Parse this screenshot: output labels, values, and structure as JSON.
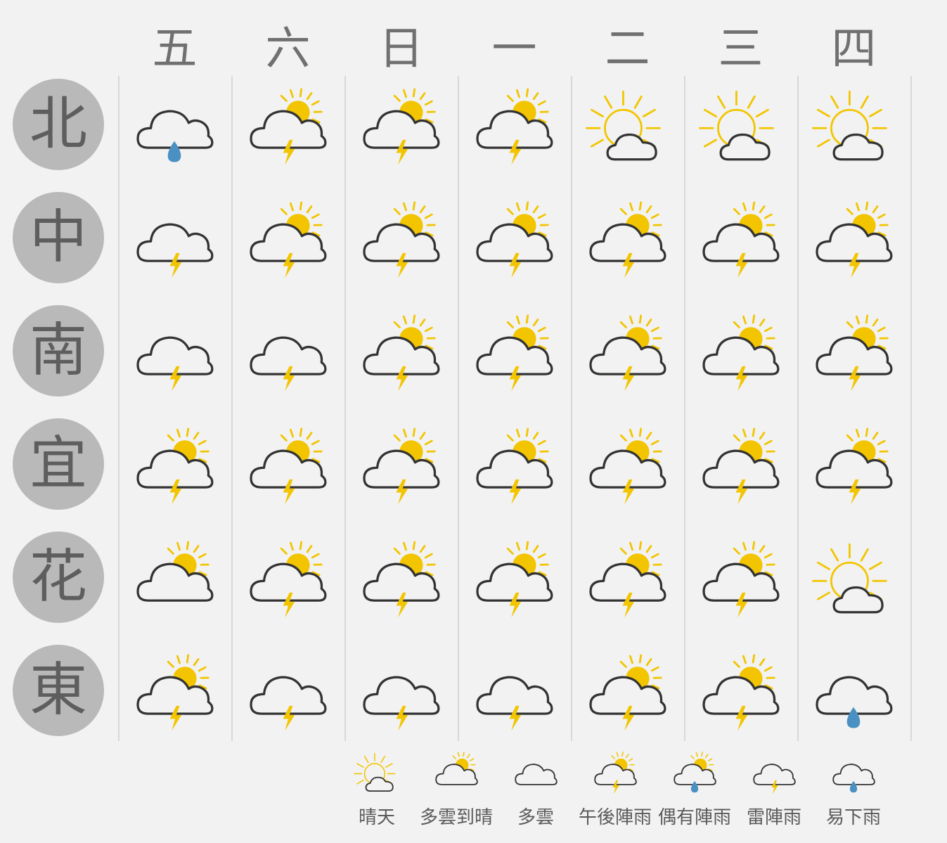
{
  "days": [
    "五",
    "六",
    "日",
    "一",
    "二",
    "三",
    "四"
  ],
  "regions": [
    {
      "name": "北",
      "forecast": [
        "rain",
        "thunder_sun",
        "thunder_sun",
        "thunder_sun",
        "sunny",
        "sunny",
        "sunny"
      ]
    },
    {
      "name": "中",
      "forecast": [
        "thunder",
        "thunder_sun",
        "thunder_sun",
        "thunder_sun",
        "thunder_sun",
        "thunder_sun",
        "thunder_sun"
      ]
    },
    {
      "name": "南",
      "forecast": [
        "thunder",
        "thunder",
        "thunder_sun",
        "thunder_sun",
        "thunder_sun",
        "thunder_sun",
        "thunder_sun"
      ]
    },
    {
      "name": "宜",
      "forecast": [
        "thunder_sun",
        "thunder_sun",
        "thunder_sun",
        "thunder_sun",
        "thunder_sun",
        "thunder_sun",
        "thunder_sun"
      ]
    },
    {
      "name": "花",
      "forecast": [
        "partly",
        "thunder_sun",
        "thunder_sun",
        "thunder_sun",
        "thunder_sun",
        "thunder_sun",
        "sunny"
      ]
    },
    {
      "name": "東",
      "forecast": [
        "thunder_sun",
        "thunder",
        "thunder",
        "thunder",
        "thunder_sun",
        "thunder_sun",
        "rain"
      ]
    }
  ],
  "legend": [
    {
      "icon": "sunny",
      "label": "晴天"
    },
    {
      "icon": "partly",
      "label": "多雲到晴"
    },
    {
      "icon": "cloudy",
      "label": "多雲"
    },
    {
      "icon": "thunder_sun",
      "label": "午後陣雨"
    },
    {
      "icon": "rain_sun",
      "label": "偶有陣雨"
    },
    {
      "icon": "thunder",
      "label": "雷陣雨"
    },
    {
      "icon": "rain",
      "label": "易下雨"
    }
  ],
  "icon_names": {
    "sunny": "sunny-icon",
    "partly": "partly-cloudy-icon",
    "cloudy": "cloud-icon",
    "thunder_sun": "afternoon-thunder-shower-icon",
    "rain_sun": "occasional-shower-icon",
    "thunder": "thunderstorm-icon",
    "rain": "rain-icon"
  },
  "colors": {
    "background": "#f2f2f2",
    "sun": "#f2c500",
    "bolt": "#f2c500",
    "raindrop": "#4a90c2",
    "cloud_outline": "#333333",
    "region_circle": "#b9b9b9",
    "region_text": "#5e5e5e",
    "day_text": "#707070",
    "divider": "#d8d8d8"
  }
}
